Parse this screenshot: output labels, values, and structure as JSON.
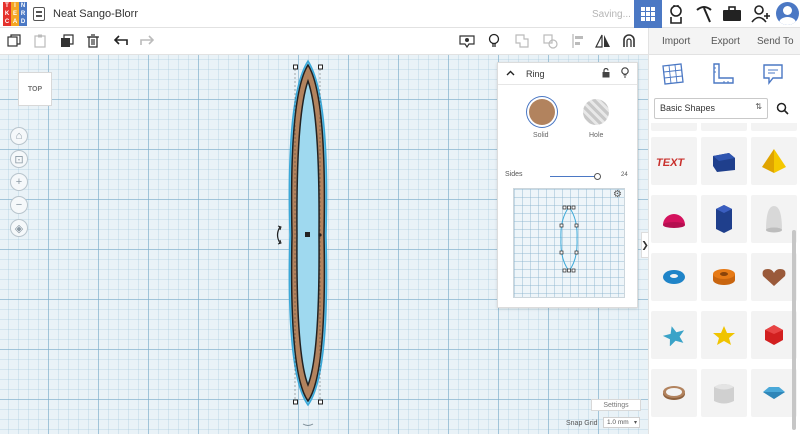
{
  "app": {
    "logo_letters": [
      "T",
      "I",
      "N",
      "K",
      "E",
      "R",
      "C",
      "A",
      "D"
    ],
    "logo_colors": [
      "#e5322d",
      "#f5a623",
      "#4b78c4",
      "#e5322d",
      "#f5a623",
      "#4b78c4",
      "#e5322d",
      "#f5a623",
      "#4b78c4"
    ],
    "document_title": "Neat Sango-Blorr",
    "status": "Saving...",
    "accent_color": "#4b78c4"
  },
  "header": {
    "icons": [
      "3d-design-grid-icon",
      "lightbulb-hand-icon",
      "pickaxe-icon",
      "briefcase-icon",
      "add-user-icon",
      "avatar"
    ]
  },
  "toolbar": {
    "left_icons": [
      "copy-icon",
      "paste-icon",
      "duplicate-icon",
      "delete-icon",
      "undo-icon",
      "redo-icon"
    ],
    "right_icons": [
      "camera-view-icon",
      "lightbulb-icon",
      "group-icon",
      "ungroup-icon",
      "align-icon",
      "mirror-icon",
      "workplane-magnet-icon"
    ],
    "import_label": "Import",
    "export_label": "Export",
    "send_to_label": "Send To"
  },
  "workplane": {
    "view_cube_label": "TOP",
    "nav_icons": [
      "home-icon",
      "fit-view-icon",
      "zoom-in-icon",
      "zoom-out-icon",
      "orthographic-icon"
    ],
    "selected_shape": "Ring",
    "shape_color": "#b2835e"
  },
  "inspector": {
    "shape_name": "Ring",
    "solid_label": "Solid",
    "hole_label": "Hole",
    "solid_color": "#b2835e",
    "sides_label": "Sides",
    "sides_value": "24",
    "sides_fraction": 0.92
  },
  "footer": {
    "settings_label": "Settings",
    "snap_grid_label": "Snap Grid",
    "snap_grid_value": "1.0 mm"
  },
  "shape_panel": {
    "category_icons": [
      "workplane-grid-icon",
      "ruler-icon",
      "note-icon"
    ],
    "library_label": "Basic Shapes",
    "shapes": [
      {
        "name": "text-3d",
        "color": "#c9302c"
      },
      {
        "name": "box",
        "color": "#1f3f8c"
      },
      {
        "name": "pyramid",
        "color": "#f0b400"
      },
      {
        "name": "half-sphere",
        "color": "#d4125d"
      },
      {
        "name": "polygon",
        "color": "#1f3f8c"
      },
      {
        "name": "paraboloid",
        "color": "#d8d8d8"
      },
      {
        "name": "torus",
        "color": "#1f84c8"
      },
      {
        "name": "tube",
        "color": "#e67a16"
      },
      {
        "name": "heart",
        "color": "#9a5a3a"
      },
      {
        "name": "star",
        "color": "#3aa3c8"
      },
      {
        "name": "star-thick",
        "color": "#f0c400"
      },
      {
        "name": "icosahedron",
        "color": "#d21f1f"
      },
      {
        "name": "ring",
        "color": "#b2835e"
      },
      {
        "name": "round-roof",
        "color": "#d0d0d0"
      },
      {
        "name": "diamond",
        "color": "#4aa8d8"
      }
    ]
  }
}
